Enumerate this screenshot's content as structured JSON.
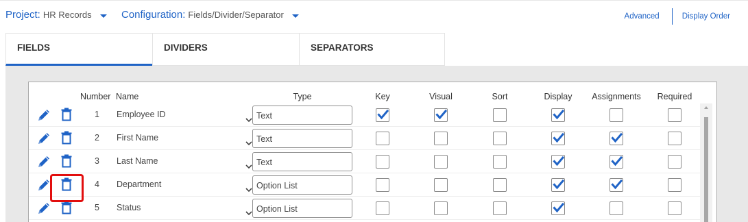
{
  "project": {
    "label": "Project:",
    "value": "HR Records"
  },
  "configuration": {
    "label": "Configuration:",
    "value": "Fields/Divider/Separator"
  },
  "links": {
    "advanced": "Advanced",
    "display_order": "Display Order"
  },
  "tabs": [
    {
      "label": "FIELDS",
      "active": true
    },
    {
      "label": "DIVIDERS",
      "active": false
    },
    {
      "label": "SEPARATORS",
      "active": false
    }
  ],
  "columns": {
    "number": "Number",
    "name": "Name",
    "type": "Type",
    "key": "Key",
    "visual": "Visual",
    "sort": "Sort",
    "display": "Display",
    "assignments": "Assignments",
    "required": "Required"
  },
  "rows": [
    {
      "number": "1",
      "name": "Employee ID",
      "type": "Text",
      "key": true,
      "visual": true,
      "sort": false,
      "display": true,
      "assignments": false,
      "required": false
    },
    {
      "number": "2",
      "name": "First Name",
      "type": "Text",
      "key": false,
      "visual": false,
      "sort": false,
      "display": true,
      "assignments": true,
      "required": false
    },
    {
      "number": "3",
      "name": "Last Name",
      "type": "Text",
      "key": false,
      "visual": false,
      "sort": false,
      "display": true,
      "assignments": true,
      "required": false
    },
    {
      "number": "4",
      "name": "Department",
      "type": "Option List",
      "key": false,
      "visual": false,
      "sort": false,
      "display": true,
      "assignments": true,
      "required": false
    },
    {
      "number": "5",
      "name": "Status",
      "type": "Option List",
      "key": false,
      "visual": false,
      "sort": false,
      "display": true,
      "assignments": false,
      "required": false
    }
  ],
  "icons": {
    "edit": "pencil-icon",
    "delete": "trash-icon",
    "dropdown": "chevron-down-icon",
    "check": "checkmark-icon"
  },
  "colors": {
    "accent": "#1f63c6",
    "highlight": "#e20e0e",
    "panel": "#e8e8e8"
  },
  "highlighted_row": 4
}
